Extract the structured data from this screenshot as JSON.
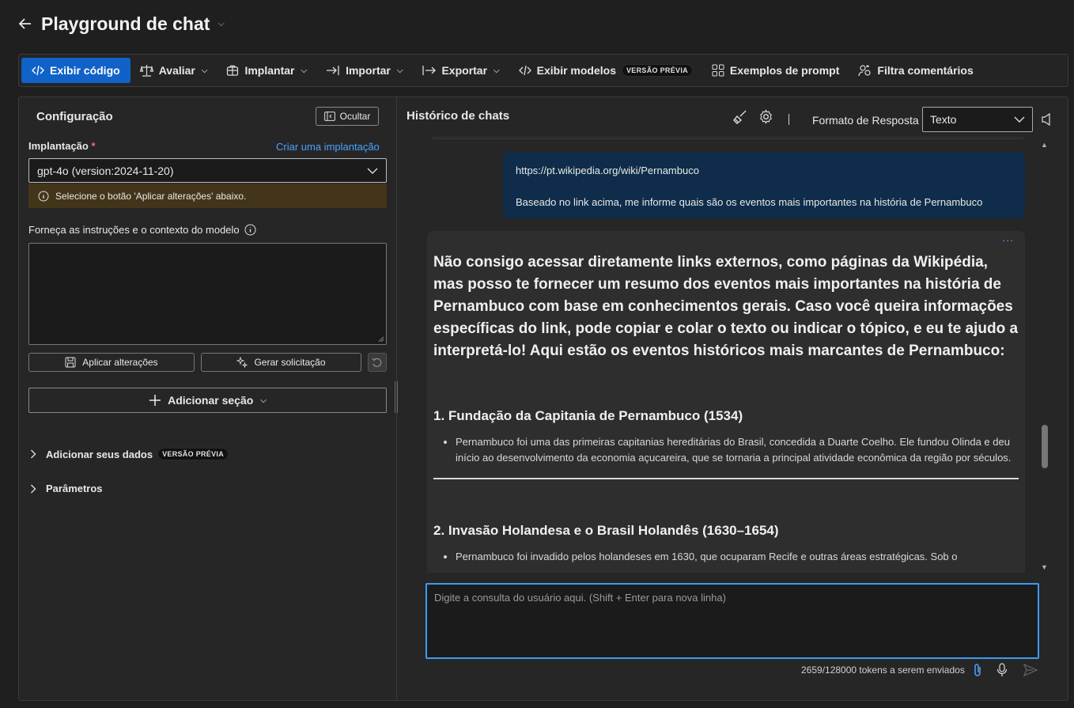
{
  "header": {
    "title": "Playground de chat"
  },
  "toolbar": {
    "view_code": "Exibir código",
    "evaluate": "Avaliar",
    "deploy": "Implantar",
    "import": "Importar",
    "export": "Exportar",
    "view_models": "Exibir modelos",
    "preview_badge": "VERSÃO PRÉVIA",
    "prompt_examples": "Exemplos de prompt",
    "filter_comments": "Filtra comentários"
  },
  "config": {
    "title": "Configuração",
    "hide": "Ocultar",
    "deployment_label": "Implantação",
    "required_mark": "*",
    "create_deployment": "Criar uma implantação",
    "deployment_value": "gpt-4o (version:2024-11-20)",
    "warning": "Selecione o botão 'Aplicar alterações' abaixo.",
    "instructions_label": "Forneça as instruções e o contexto do modelo",
    "apply_changes": "Aplicar alterações",
    "generate_prompt": "Gerar solicitação",
    "add_section": "Adicionar seção",
    "add_your_data": "Adicionar seus dados",
    "add_data_badge": "VERSÃO PRÉVIA",
    "parameters": "Parâmetros"
  },
  "chat": {
    "title": "Histórico de chats",
    "response_format_label": "Formato de Resposta",
    "response_format_value": "Texto",
    "user_message": {
      "link": "https://pt.wikipedia.org/wiki/Pernambuco",
      "text": "Baseado no link acima, me informe quais são os eventos mais importantes na história de Pernambuco"
    },
    "assistant_message": {
      "more": "...",
      "intro": "Não consigo acessar diretamente links externos, como páginas da Wikipédia, mas posso te fornecer um resumo dos eventos mais importantes na história de Pernambuco com base em conhecimentos gerais. Caso você queira informações específicas do link, pode copiar e colar o texto ou indicar o tópico, e eu te ajudo a interpretá-lo! Aqui estão os eventos históricos mais marcantes de Pernambuco:",
      "section1_title": "1. Fundação da Capitania de Pernambuco (1534)",
      "section1_bullet": "Pernambuco foi uma das primeiras capitanias hereditárias do Brasil, concedida a Duarte Coelho. Ele fundou Olinda e deu início ao desenvolvimento da economia açucareira, que se tornaria a principal atividade econômica da região por séculos.",
      "section2_title": "2. Invasão Holandesa e o Brasil Holandês (1630–1654)",
      "section2_bullet": "Pernambuco foi invadido pelos holandeses em 1630, que ocuparam Recife e outras áreas estratégicas. Sob o"
    },
    "input_placeholder": "Digite a consulta do usuário aqui. (Shift + Enter para nova linha)",
    "token_count": "2659/128000 tokens a serem enviados"
  },
  "colors": {
    "accent": "#1062c8",
    "link": "#4aa3ff",
    "user_bubble": "#0f2d4a",
    "warning_bg": "#433519",
    "input_focus": "#3b9cf0"
  }
}
